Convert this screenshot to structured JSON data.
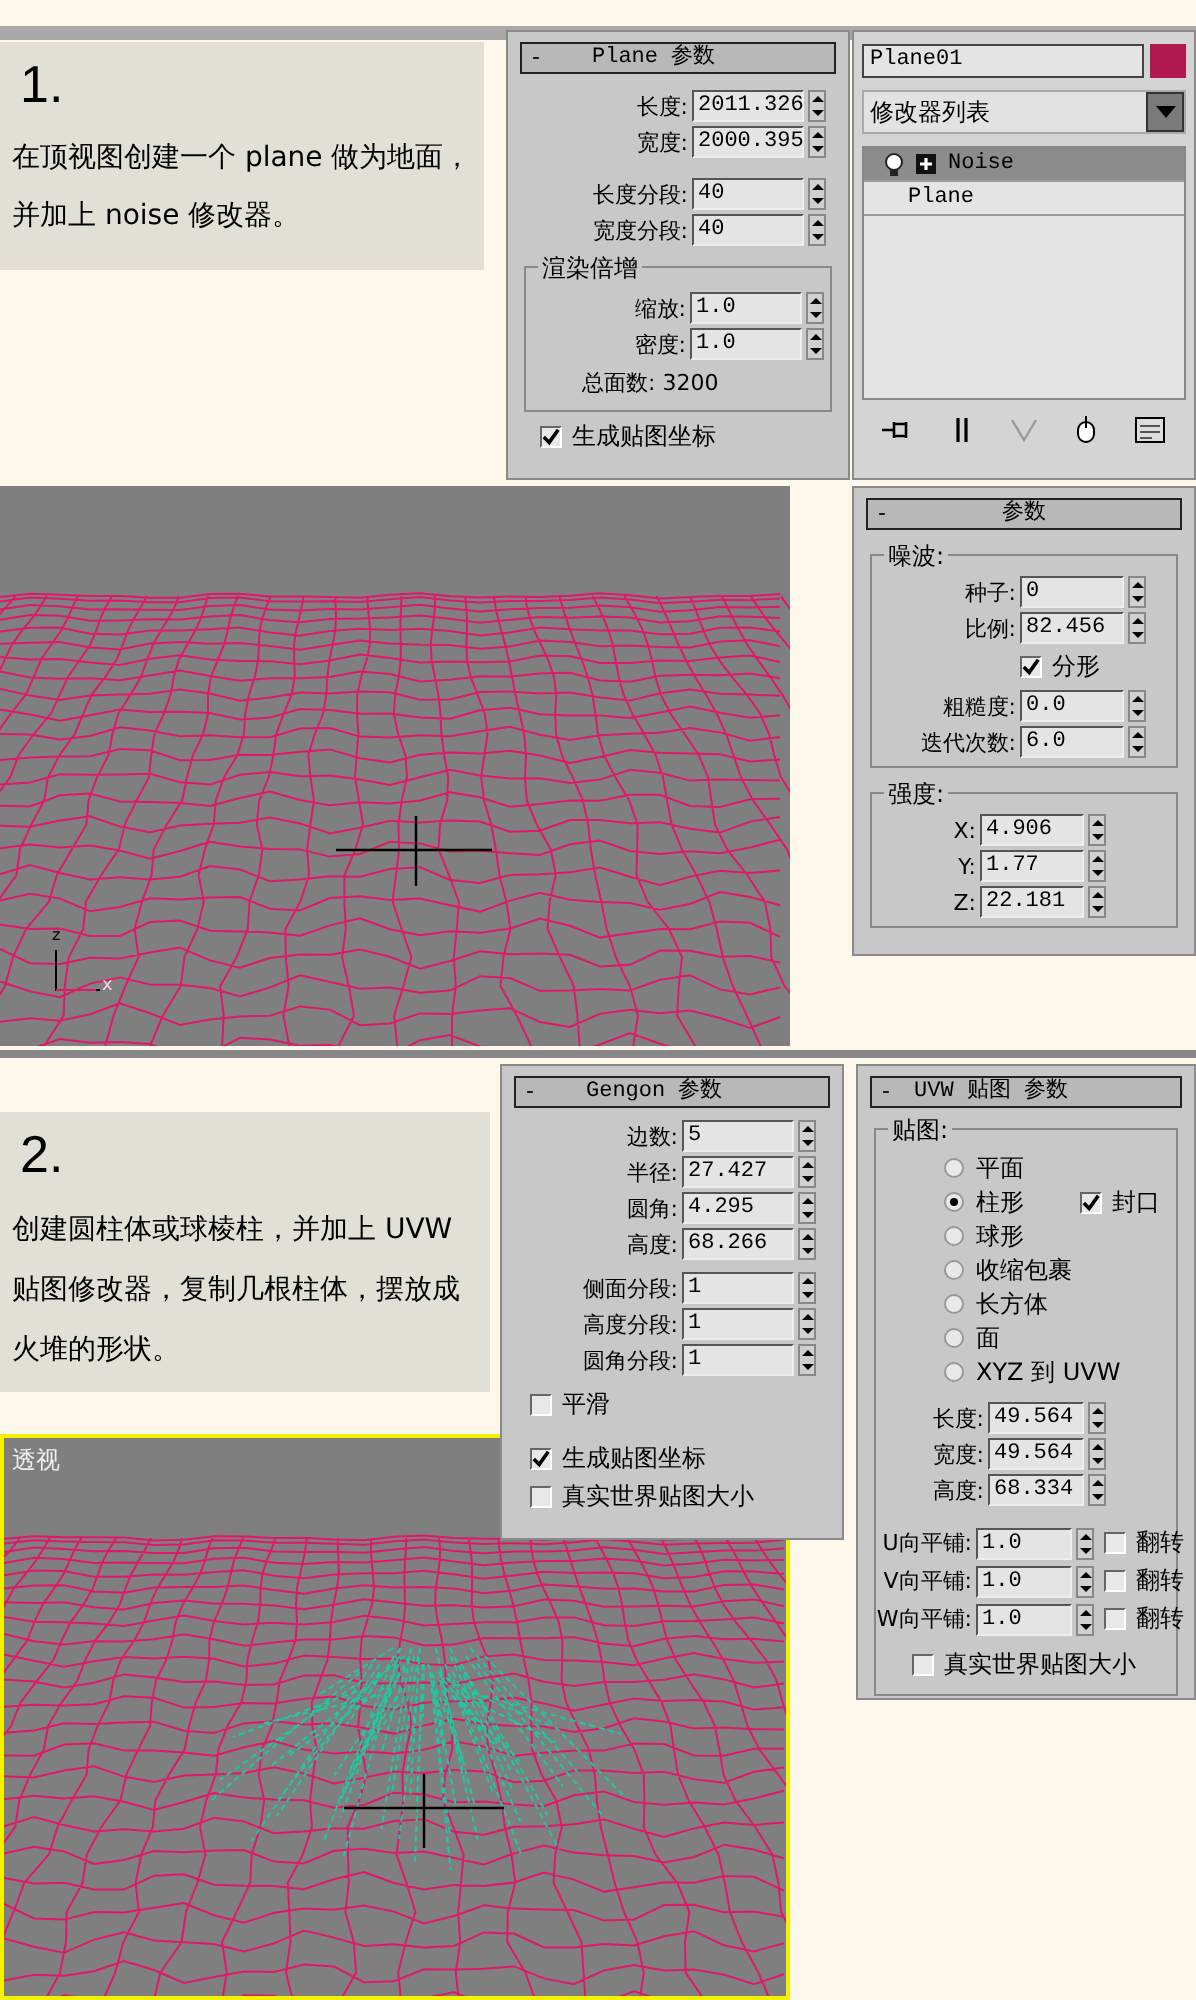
{
  "step1": {
    "number": "1.",
    "text": "在顶视图创建一个 plane 做为地面，并加上 noise 修改器。"
  },
  "plane_panel": {
    "collapse": "-",
    "title": "Plane 参数",
    "fields": [
      {
        "label": "长度:",
        "value": "2011.326"
      },
      {
        "label": "宽度:",
        "value": "2000.395"
      }
    ],
    "segments": [
      {
        "label": "长度分段:",
        "value": "40"
      },
      {
        "label": "宽度分段:",
        "value": "40"
      }
    ],
    "render_group": {
      "title": "渲染倍增",
      "fields": [
        {
          "label": "缩放:",
          "value": "1.0"
        },
        {
          "label": "密度:",
          "value": "1.0"
        }
      ],
      "total": "总面数: 3200"
    },
    "checkbox": {
      "label": "生成贴图坐标",
      "checked": true
    }
  },
  "modifier_panel": {
    "object_name": "Plane01",
    "dropdown": "修改器列表",
    "stack": [
      {
        "label": "Noise",
        "selected": true
      },
      {
        "label": "Plane",
        "selected": false
      }
    ]
  },
  "noise_panel": {
    "collapse": "-",
    "title": "参数",
    "noise_group": {
      "title": "噪波:",
      "fields": [
        {
          "label": "种子:",
          "value": "0"
        },
        {
          "label": "比例:",
          "value": "82.456"
        }
      ],
      "fractal": {
        "label": "分形",
        "checked": true
      },
      "fields2": [
        {
          "label": "粗糙度:",
          "value": "0.0"
        },
        {
          "label": "迭代次数:",
          "value": "6.0"
        }
      ]
    },
    "strength_group": {
      "title": "强度:",
      "fields": [
        {
          "label": "X:",
          "value": "4.906"
        },
        {
          "label": "Y:",
          "value": "1.77"
        },
        {
          "label": "Z:",
          "value": "22.181"
        }
      ]
    }
  },
  "viewport1": {
    "axis_labels": [
      "z",
      "x"
    ]
  },
  "step2": {
    "number": "2.",
    "text": "创建圆柱体或球棱柱，并加上 UVW 贴图修改器，复制几根柱体，摆放成火堆的形状。"
  },
  "viewport2": {
    "label": "透视"
  },
  "gengon_panel": {
    "collapse": "-",
    "title": "Gengon 参数",
    "fields": [
      {
        "label": "边数:",
        "value": "5"
      },
      {
        "label": "半径:",
        "value": "27.427"
      },
      {
        "label": "圆角:",
        "value": "4.295"
      },
      {
        "label": "高度:",
        "value": "68.266"
      }
    ],
    "segments": [
      {
        "label": "侧面分段:",
        "value": "1"
      },
      {
        "label": "高度分段:",
        "value": "1"
      },
      {
        "label": "圆角分段:",
        "value": "1"
      }
    ],
    "checkboxes": [
      {
        "label": "平滑",
        "checked": false
      },
      {
        "label": "生成贴图坐标",
        "checked": true
      },
      {
        "label": "真实世界贴图大小",
        "checked": false
      }
    ]
  },
  "uvw_panel": {
    "collapse": "-",
    "title": "UVW 贴图 参数",
    "group_title": "贴图:",
    "radios": [
      {
        "label": "平面",
        "selected": false
      },
      {
        "label": "柱形",
        "selected": true
      },
      {
        "label": "球形",
        "selected": false
      },
      {
        "label": "收缩包裹",
        "selected": false
      },
      {
        "label": "长方体",
        "selected": false
      },
      {
        "label": "面",
        "selected": false
      },
      {
        "label": "XYZ 到 UVW",
        "selected": false
      }
    ],
    "cap": {
      "label": "封口",
      "checked": true
    },
    "fields": [
      {
        "label": "长度:",
        "value": "49.564"
      },
      {
        "label": "宽度:",
        "value": "49.564"
      },
      {
        "label": "高度:",
        "value": "68.334"
      }
    ],
    "tiles": [
      {
        "label": "U向平铺:",
        "value": "1.0",
        "flip": {
          "label": "翻转",
          "checked": false
        }
      },
      {
        "label": "V向平铺:",
        "value": "1.0",
        "flip": {
          "label": "翻转",
          "checked": false
        }
      },
      {
        "label": "W向平铺:",
        "value": "1.0",
        "flip": {
          "label": "翻转",
          "checked": false
        }
      }
    ],
    "real_world": {
      "label": "真实世界贴图大小",
      "checked": false
    }
  }
}
